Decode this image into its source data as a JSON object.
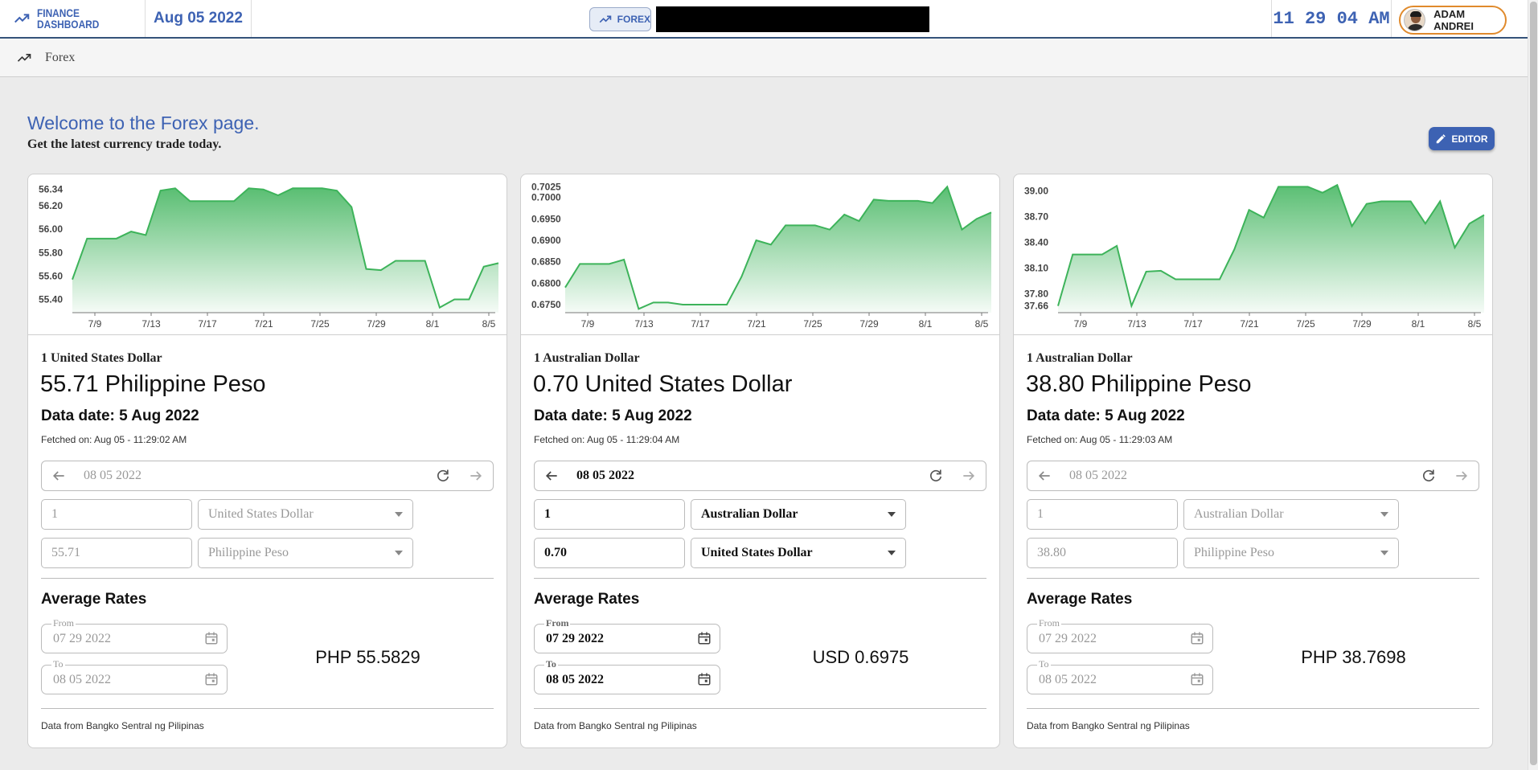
{
  "header": {
    "brand_line1": "FINANCE",
    "brand_line2": "DASHBOARD",
    "date": "Aug 05 2022",
    "forex_chip": "FOREX",
    "clock": "11 29 04 AM",
    "user_name": "ADAM ANDREI",
    "accent": "#3d62b3"
  },
  "breadcrumb": {
    "label": "Forex",
    "icon": "trending-up-icon"
  },
  "page": {
    "welcome": "Welcome to the Forex page.",
    "subtitle": "Get the latest currency trade today.",
    "editor_label": "EDITOR"
  },
  "cards": [
    {
      "base": "1 United States Dollar",
      "rate": "55.71 Philippine Peso",
      "data_date": "Data date: 5 Aug 2022",
      "fetched": "Fetched on: Aug 05 - 11:29:02 AM",
      "selected_date": "08 05 2022",
      "amount_from": "1",
      "currency_from": "United States Dollar",
      "amount_to": "55.71",
      "currency_to": "Philippine Peso",
      "enabled": false,
      "avg_title": "Average Rates",
      "from_label": "From",
      "from_date": "07 29 2022",
      "to_label": "To",
      "to_date": "08 05 2022",
      "avg_value": "PHP 55.5829",
      "source": "Data from Bangko Sentral ng Pilipinas"
    },
    {
      "base": "1 Australian Dollar",
      "rate": "0.70 United States Dollar",
      "data_date": "Data date: 5 Aug 2022",
      "fetched": "Fetched on: Aug 05 - 11:29:04 AM",
      "selected_date": "08 05 2022",
      "amount_from": "1",
      "currency_from": "Australian Dollar",
      "amount_to": "0.70",
      "currency_to": "United States Dollar",
      "enabled": true,
      "avg_title": "Average Rates",
      "from_label": "From",
      "from_date": "07 29 2022",
      "to_label": "To",
      "to_date": "08 05 2022",
      "avg_value": "USD 0.6975",
      "source": "Data from Bangko Sentral ng Pilipinas"
    },
    {
      "base": "1 Australian Dollar",
      "rate": "38.80 Philippine Peso",
      "data_date": "Data date: 5 Aug 2022",
      "fetched": "Fetched on: Aug 05 - 11:29:03 AM",
      "selected_date": "08 05 2022",
      "amount_from": "1",
      "currency_from": "Australian Dollar",
      "amount_to": "38.80",
      "currency_to": "Philippine Peso",
      "enabled": false,
      "avg_title": "Average Rates",
      "from_label": "From",
      "from_date": "07 29 2022",
      "to_label": "To",
      "to_date": "08 05 2022",
      "avg_value": "PHP 38.7698",
      "source": "Data from Bangko Sentral ng Pilipinas"
    }
  ],
  "chart_data": [
    {
      "type": "area",
      "color": "#3db35a",
      "x_ticks": [
        "7/9",
        "7/13",
        "7/17",
        "7/21",
        "7/25",
        "7/29",
        "8/1",
        "8/5"
      ],
      "y_ticks": [
        "56.34",
        "56.20",
        "56.00",
        "55.80",
        "55.60",
        "55.40"
      ],
      "y_tick_values": [
        56.34,
        56.2,
        56.0,
        55.8,
        55.6,
        55.4
      ],
      "ylim": [
        55.3,
        56.4
      ],
      "x": [
        "7/7",
        "7/8",
        "7/11",
        "7/12",
        "7/13",
        "7/14",
        "7/15",
        "7/18",
        "7/19",
        "7/20",
        "7/21",
        "7/22",
        "7/25",
        "7/26",
        "7/27",
        "7/28",
        "7/29",
        "8/1",
        "8/2",
        "8/3",
        "8/4",
        "8/5",
        "8/5b"
      ],
      "values": [
        55.57,
        55.92,
        55.92,
        55.92,
        55.98,
        55.95,
        56.33,
        56.35,
        56.24,
        56.24,
        56.24,
        56.24,
        56.35,
        56.34,
        56.29,
        56.35,
        56.35,
        56.35,
        56.33,
        56.19,
        55.66,
        55.65,
        55.73,
        55.73,
        55.73,
        55.33,
        55.4,
        55.4,
        55.68,
        55.71
      ]
    },
    {
      "type": "area",
      "color": "#3db35a",
      "x_ticks": [
        "7/9",
        "7/13",
        "7/17",
        "7/21",
        "7/25",
        "7/29",
        "8/1",
        "8/5"
      ],
      "y_ticks": [
        "0.7025",
        "0.7000",
        "0.6950",
        "0.6900",
        "0.6850",
        "0.6800",
        "0.6750"
      ],
      "y_tick_values": [
        0.7025,
        0.7,
        0.695,
        0.69,
        0.685,
        0.68,
        0.675
      ],
      "ylim": [
        0.6735,
        0.7035
      ],
      "values": [
        0.679,
        0.6845,
        0.6845,
        0.6845,
        0.6855,
        0.674,
        0.6755,
        0.6755,
        0.675,
        0.675,
        0.675,
        0.675,
        0.6815,
        0.69,
        0.689,
        0.6935,
        0.6935,
        0.6935,
        0.6925,
        0.696,
        0.6945,
        0.6995,
        0.6992,
        0.6992,
        0.6992,
        0.6987,
        0.7025,
        0.6925,
        0.695,
        0.6965
      ]
    },
    {
      "type": "area",
      "color": "#3db35a",
      "x_ticks": [
        "7/9",
        "7/13",
        "7/17",
        "7/21",
        "7/25",
        "7/29",
        "8/1",
        "8/5"
      ],
      "y_ticks": [
        "39.00",
        "38.70",
        "38.40",
        "38.10",
        "37.80",
        "37.66"
      ],
      "y_tick_values": [
        39.0,
        38.7,
        38.4,
        38.1,
        37.8,
        37.66
      ],
      "ylim": [
        37.6,
        39.1
      ],
      "values": [
        37.66,
        38.26,
        38.26,
        38.26,
        38.36,
        37.66,
        38.06,
        38.07,
        37.97,
        37.97,
        37.97,
        37.97,
        38.32,
        38.78,
        38.69,
        39.05,
        39.05,
        39.05,
        38.98,
        39.07,
        38.59,
        38.85,
        38.88,
        38.88,
        38.88,
        38.62,
        38.88,
        38.34,
        38.62,
        38.72
      ]
    }
  ]
}
